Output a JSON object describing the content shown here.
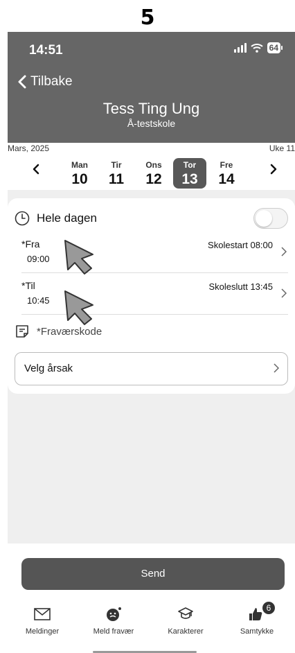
{
  "step": "5",
  "status_bar": {
    "time": "14:51",
    "battery": "64"
  },
  "header": {
    "back_label": "Tilbake",
    "title": "Tess Ting Ung",
    "subtitle": "Å-testskole"
  },
  "calendar": {
    "month": "Mars, 2025",
    "week": "Uke 11",
    "days": [
      {
        "name": "Man",
        "date": "10"
      },
      {
        "name": "Tir",
        "date": "11"
      },
      {
        "name": "Ons",
        "date": "12"
      },
      {
        "name": "Tor",
        "date": "13"
      },
      {
        "name": "Fre",
        "date": "14"
      }
    ],
    "selected_index": 3
  },
  "form": {
    "all_day_label": "Hele dagen",
    "all_day_on": false,
    "from": {
      "label": "*Fra",
      "value": "09:00",
      "info": "Skolestart 08:00"
    },
    "to": {
      "label": "*Til",
      "value": "10:45",
      "info": "Skoleslutt 13:45"
    },
    "absence_code_label": "*Fraværskode",
    "reason_select": "Velg årsak"
  },
  "send_label": "Send",
  "tabs": [
    {
      "label": "Meldinger",
      "icon": "envelope-icon"
    },
    {
      "label": "Meld fravær",
      "icon": "report-absence-icon"
    },
    {
      "label": "Karakterer",
      "icon": "graduation-cap-icon"
    },
    {
      "label": "Samtykke",
      "icon": "thumbs-up-icon",
      "badge": "6"
    }
  ],
  "colors": {
    "header_bg": "#666666",
    "selected_day": "#585858",
    "send_button": "#555555",
    "content_bg": "#efefef"
  }
}
